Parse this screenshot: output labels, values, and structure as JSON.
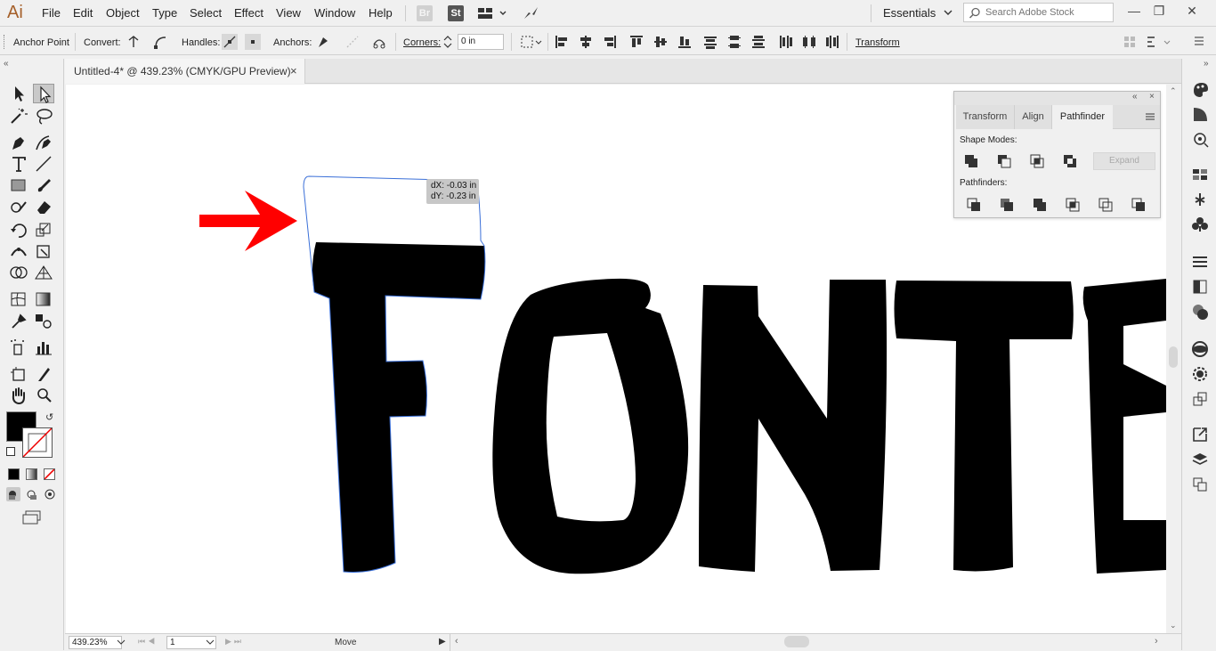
{
  "app": {
    "logo": "Ai"
  },
  "menu": [
    "File",
    "Edit",
    "Object",
    "Type",
    "Select",
    "Effect",
    "View",
    "Window",
    "Help"
  ],
  "menubar_icons": {
    "bridge": "Br",
    "stock": "St"
  },
  "workspace": "Essentials",
  "search": {
    "placeholder": "Search Adobe Stock"
  },
  "control_bar": {
    "tool_name": "Anchor Point",
    "convert_label": "Convert:",
    "handles_label": "Handles:",
    "anchors_label": "Anchors:",
    "corners_label": "Corners:",
    "corners_value": "0 in",
    "transform_label": "Transform"
  },
  "document": {
    "tab_title": "Untitled-4* @ 439.23% (CMYK/GPU Preview)",
    "close": "×"
  },
  "artwork": {
    "text": "FONTE"
  },
  "tooltip": {
    "dx": "dX: -0.03 in",
    "dy": "dY: -0.23 in"
  },
  "pathfinder_panel": {
    "tabs": [
      "Transform",
      "Align",
      "Pathfinder"
    ],
    "active_tab": "Pathfinder",
    "shape_modes_label": "Shape Modes:",
    "pathfinders_label": "Pathfinders:",
    "expand_label": "Expand"
  },
  "status_bar": {
    "zoom": "439.23%",
    "artboard": "1",
    "tool_status": "Move"
  },
  "colors": {
    "accent_arrow": "#ff0000",
    "selection": "#3a6fd8",
    "logo": "#a5602a"
  }
}
